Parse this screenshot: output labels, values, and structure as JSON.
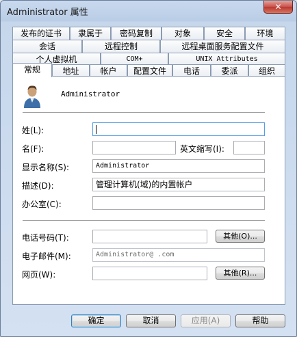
{
  "window": {
    "title": "Administrator 属性",
    "close_label": "✕"
  },
  "tabs": {
    "row1": [
      "发布的证书",
      "隶属于",
      "密码复制",
      "对象",
      "安全",
      "环境"
    ],
    "row2": [
      "会话",
      "远程控制",
      "远程桌面服务配置文件"
    ],
    "row3": [
      "个人虚拟机",
      "COM+",
      "UNIX Attributes"
    ],
    "row4": [
      "常规",
      "地址",
      "帐户",
      "配置文件",
      "电话",
      "委派",
      "组织"
    ]
  },
  "general": {
    "user_name": "Administrator",
    "fields": {
      "surname_label": "姓(L):",
      "surname_value": "",
      "given_label": "名(F):",
      "given_value": "",
      "initials_label": "英文缩写(I):",
      "initials_value": "",
      "display_label": "显示名称(S):",
      "display_value": "Administrator",
      "desc_label": "描述(D):",
      "desc_value": "管理计算机(域)的内置帐户",
      "office_label": "办公室(C):",
      "office_value": "",
      "phone_label": "电话号码(T):",
      "phone_value": "",
      "phone_other": "其他(O)...",
      "email_label": "电子邮件(M):",
      "email_value": "Administrator@          .com",
      "web_label": "网页(W):",
      "web_value": "",
      "web_other": "其他(R)..."
    }
  },
  "footer": {
    "ok": "确定",
    "cancel": "取消",
    "apply": "应用(A)",
    "help": "帮助"
  }
}
